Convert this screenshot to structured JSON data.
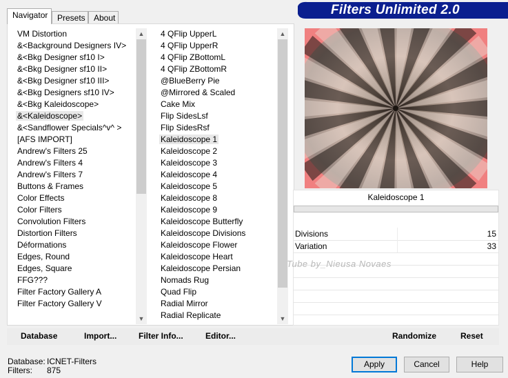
{
  "tabs": [
    {
      "label": "Navigator"
    },
    {
      "label": "Presets"
    },
    {
      "label": "About"
    }
  ],
  "banner": {
    "title": "Filters Unlimited 2.0"
  },
  "categories": {
    "selected_index": 7,
    "items": [
      " VM Distortion",
      "&<Background Designers IV>",
      "&<Bkg Designer sf10 I>",
      "&<Bkg Designer sf10 II>",
      "&<Bkg Designer sf10 III>",
      "&<Bkg Designers sf10 IV>",
      "&<Bkg Kaleidoscope>",
      "&<Kaleidoscope>",
      "&<Sandflower Specials^v^ >",
      "[AFS IMPORT]",
      "Andrew's Filters 25",
      "Andrew's Filters 4",
      "Andrew's Filters 7",
      "Buttons & Frames",
      "Color Effects",
      "Color Filters",
      "Convolution Filters",
      "Distortion Filters",
      "Déformations",
      "Edges, Round",
      "Edges, Square",
      "FFG???",
      "Filter Factory Gallery A",
      "Filter Factory Gallery V"
    ]
  },
  "filters": {
    "selected_index": 9,
    "items": [
      "4 QFlip UpperL",
      "4 QFlip UpperR",
      "4 QFlip ZBottomL",
      "4 QFlip ZBottomR",
      "@BlueBerry Pie",
      "@Mirrored & Scaled",
      "Cake Mix",
      "Flip SidesLsf",
      "Flip SidesRsf",
      "Kaleidoscope 1",
      "Kaleidoscope 2",
      "Kaleidoscope 3",
      "Kaleidoscope 4",
      "Kaleidoscope 5",
      "Kaleidoscope 8",
      "Kaleidoscope 9",
      "Kaleidoscope Butterfly",
      "Kaleidoscope Divisions",
      "Kaleidoscope Flower",
      "Kaleidoscope Heart",
      "Kaleidoscope Persian",
      "Nomads Rug",
      "Quad Flip",
      "Radial Mirror",
      "Radial Replicate"
    ]
  },
  "preview": {
    "filter_name": "Kaleidoscope 1",
    "watermark": "Tube by_Nieusa Novaes"
  },
  "params": [
    {
      "label": "Divisions",
      "value": "15"
    },
    {
      "label": "Variation",
      "value": "33"
    }
  ],
  "toolbar": {
    "database": "Database",
    "import": "Import...",
    "filter_info": "Filter Info...",
    "editor": "Editor...",
    "randomize": "Randomize",
    "reset": "Reset"
  },
  "status": {
    "database_label": "Database:",
    "database_value": "ICNET-Filters",
    "filters_label": "Filters:",
    "filters_value": "875"
  },
  "dialog_buttons": {
    "apply": "Apply",
    "cancel": "Cancel",
    "help": "Help"
  }
}
